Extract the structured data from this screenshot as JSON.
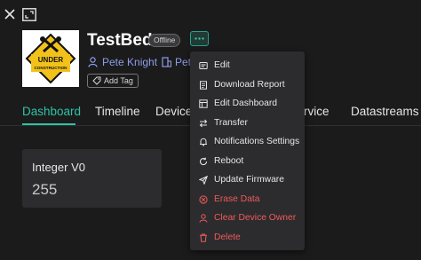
{
  "device": {
    "title": "TestBed",
    "status": "Offline",
    "owner": "Pete Knight",
    "org_truncated": "Pet",
    "add_tag_label": "Add Tag",
    "image_text": [
      "UNDER",
      "CONSTRUCTION"
    ]
  },
  "tabs": [
    {
      "label": "Dashboard",
      "active": true
    },
    {
      "label": "Timeline"
    },
    {
      "label": "Device"
    },
    {
      "label": "rvice"
    },
    {
      "label": "Datastreams"
    }
  ],
  "widget": {
    "label": "Integer V0",
    "value": "255"
  },
  "menu": {
    "items": [
      {
        "label": "Edit",
        "icon": "edit-icon"
      },
      {
        "label": "Download Report",
        "icon": "download-report-icon"
      },
      {
        "label": "Edit Dashboard",
        "icon": "edit-dashboard-icon"
      },
      {
        "label": "Transfer",
        "icon": "transfer-icon"
      },
      {
        "label": "Notifications Settings",
        "icon": "bell-icon"
      },
      {
        "label": "Reboot",
        "icon": "reboot-icon"
      },
      {
        "label": "Update Firmware",
        "icon": "send-icon"
      },
      {
        "label": "Erase Data",
        "icon": "erase-icon",
        "danger": true
      },
      {
        "label": "Clear Device Owner",
        "icon": "user-icon",
        "danger": true
      },
      {
        "label": "Delete",
        "icon": "trash-icon",
        "danger": true
      }
    ]
  },
  "colors": {
    "accent": "#2ec4a3",
    "link": "#8f9ce8",
    "danger": "#ef5a5a",
    "background": "#1b1b1c"
  }
}
